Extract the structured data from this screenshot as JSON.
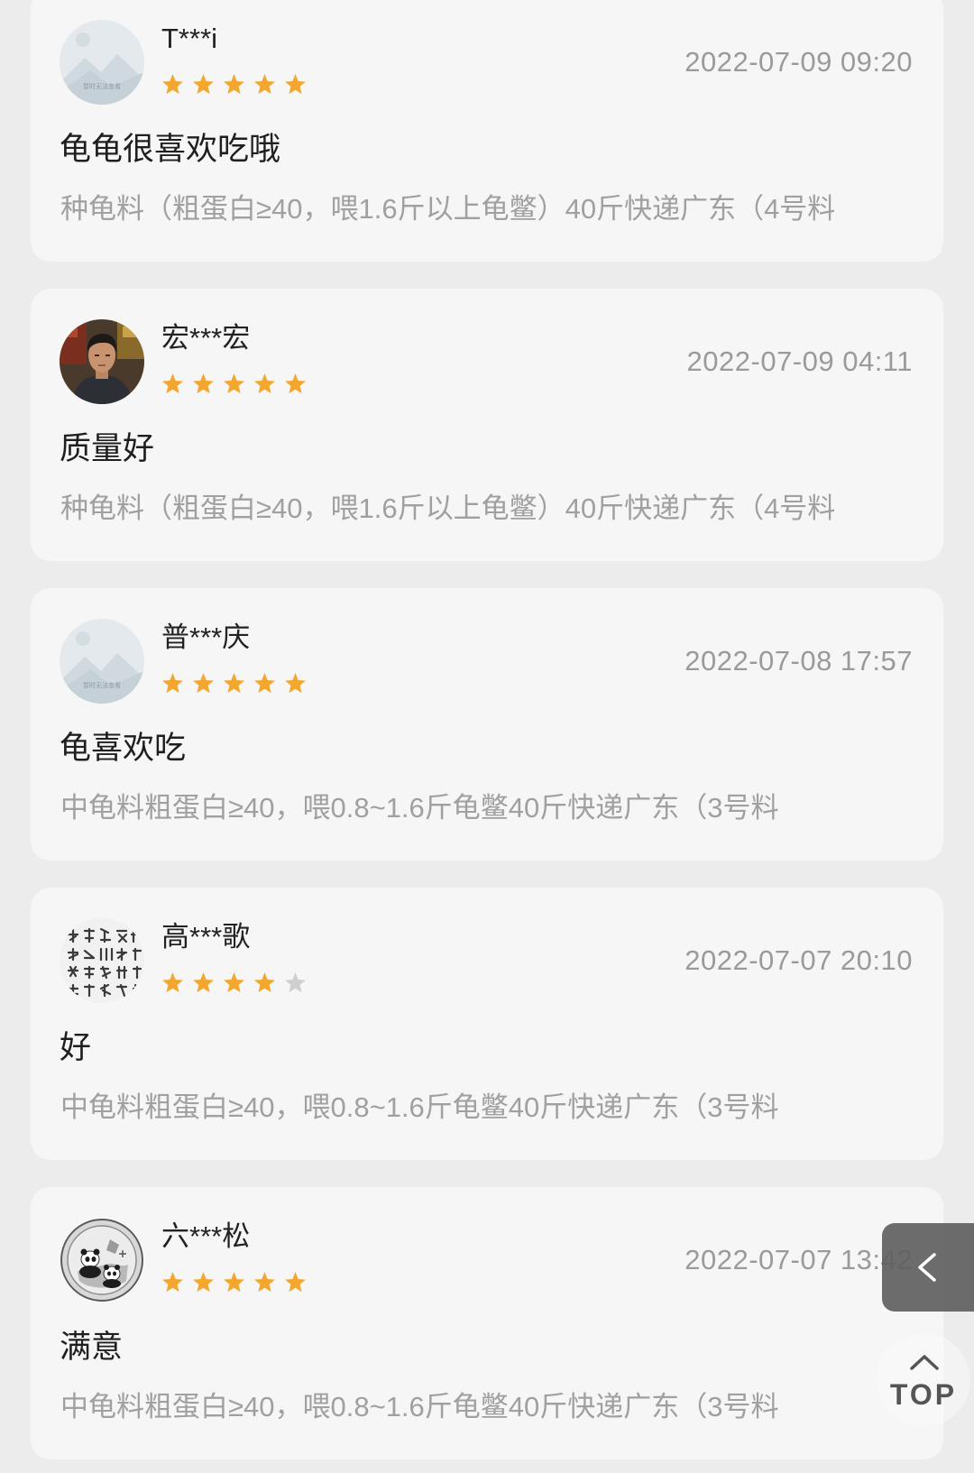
{
  "reviews": [
    {
      "username": "T***i",
      "rating": 5,
      "date": "2022-07-09 09:20",
      "comment": "龟龟很喜欢吃哦",
      "product": "种龟料（粗蛋白≥40，喂1.6斤以上龟鳖）40斤快递广东（4号料",
      "avatar": "placeholder-avatar"
    },
    {
      "username": "宏***宏",
      "rating": 5,
      "date": "2022-07-09 04:11",
      "comment": "质量好",
      "product": "种龟料（粗蛋白≥40，喂1.6斤以上龟鳖）40斤快递广东（4号料",
      "avatar": "photo-avatar"
    },
    {
      "username": "普***庆",
      "rating": 5,
      "date": "2022-07-08 17:57",
      "comment": "龟喜欢吃",
      "product": "中龟料粗蛋白≥40，喂0.8~1.6斤龟鳖40斤快递广东（3号料",
      "avatar": "placeholder-avatar"
    },
    {
      "username": "高***歌",
      "rating": 4,
      "date": "2022-07-07 20:10",
      "comment": "好",
      "product": "中龟料粗蛋白≥40，喂0.8~1.6斤龟鳖40斤快递广东（3号料",
      "avatar": "calligraphy-avatar"
    },
    {
      "username": "六***松",
      "rating": 5,
      "date": "2022-07-07 13:42",
      "comment": "满意",
      "product": "中龟料粗蛋白≥40，喂0.8~1.6斤龟鳖40斤快递广东（3号料",
      "avatar": "panda-coin-avatar"
    }
  ],
  "max_rating": 5,
  "placeholder_avatar_text": "暂时无法查看",
  "back_button": {
    "icon": "chevron-left-icon"
  },
  "top_button": {
    "label": "TOP",
    "icon": "chevron-up-icon"
  },
  "colors": {
    "page_background": "#ececec",
    "card_background": "#f6f6f6",
    "star_filled": "#f3a72f",
    "star_empty": "#cfcfcf",
    "secondary_text": "#9a9a9a",
    "primary_text": "#1f1f1f"
  }
}
